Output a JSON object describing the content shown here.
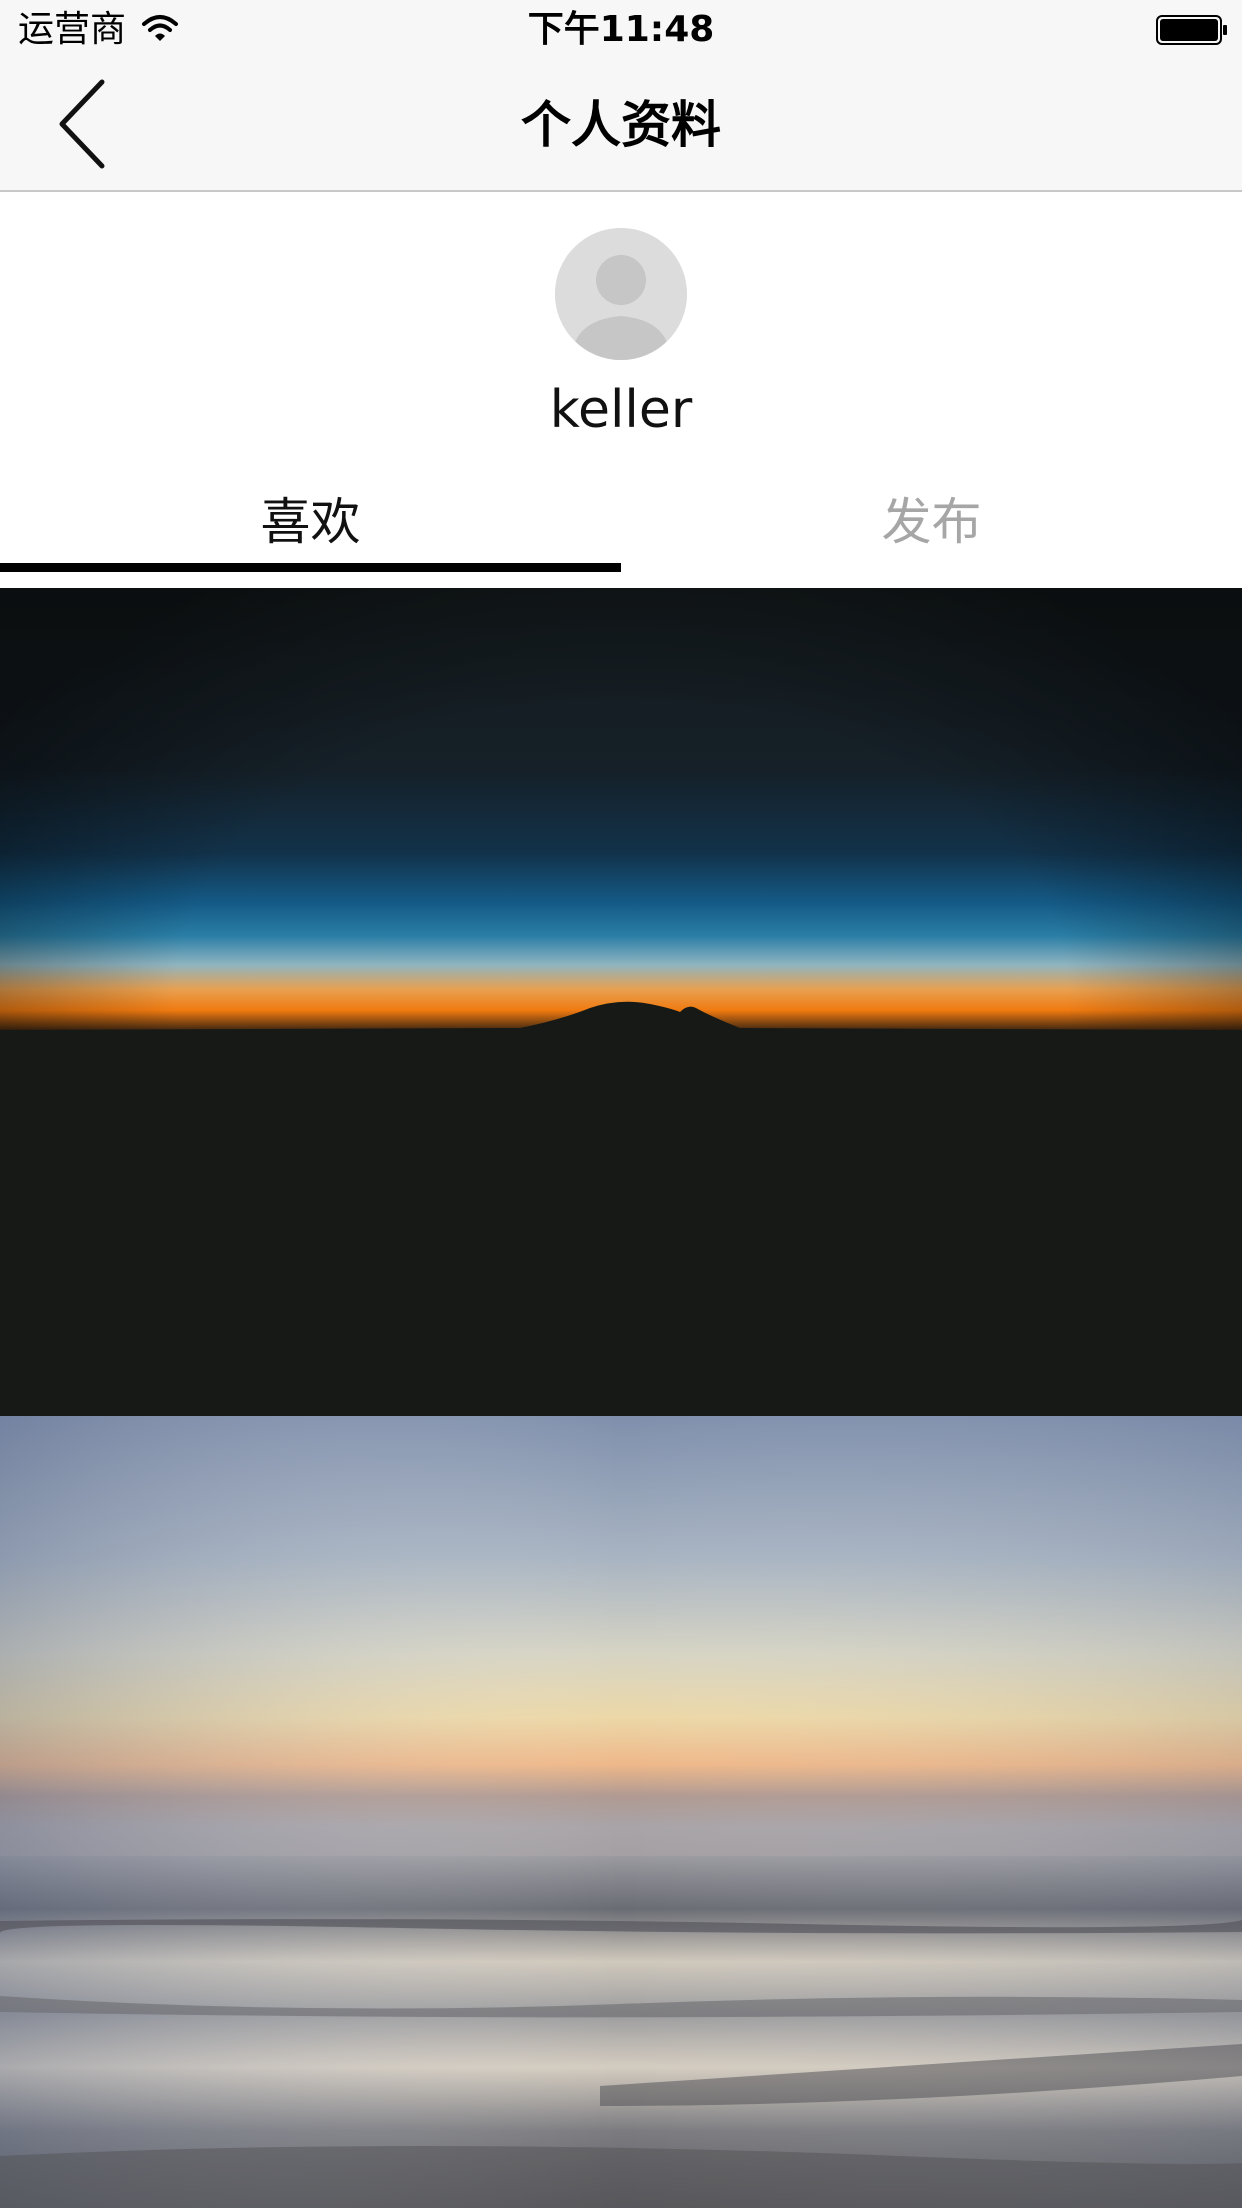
{
  "status_bar": {
    "carrier": "运营商",
    "time": "下午11:48",
    "wifi_icon": "wifi-icon",
    "battery_icon": "battery-full-icon"
  },
  "nav": {
    "back_icon": "chevron-left-icon",
    "title": "个人资料"
  },
  "profile": {
    "avatar_icon": "default-avatar-icon",
    "username": "keller"
  },
  "tabs": [
    {
      "label": "喜欢",
      "selected": true
    },
    {
      "label": "发布",
      "selected": false
    }
  ],
  "colors": {
    "nav_background": "#f7f7f7",
    "selected_tab_text": "#111111",
    "unselected_tab_text": "#a6a6a6",
    "tab_indicator": "#000000"
  },
  "feed": [
    {
      "kind": "image",
      "subject": "mountain-silhouette-at-dusk"
    },
    {
      "kind": "image",
      "subject": "blurred-seascape-at-sunset"
    }
  ]
}
